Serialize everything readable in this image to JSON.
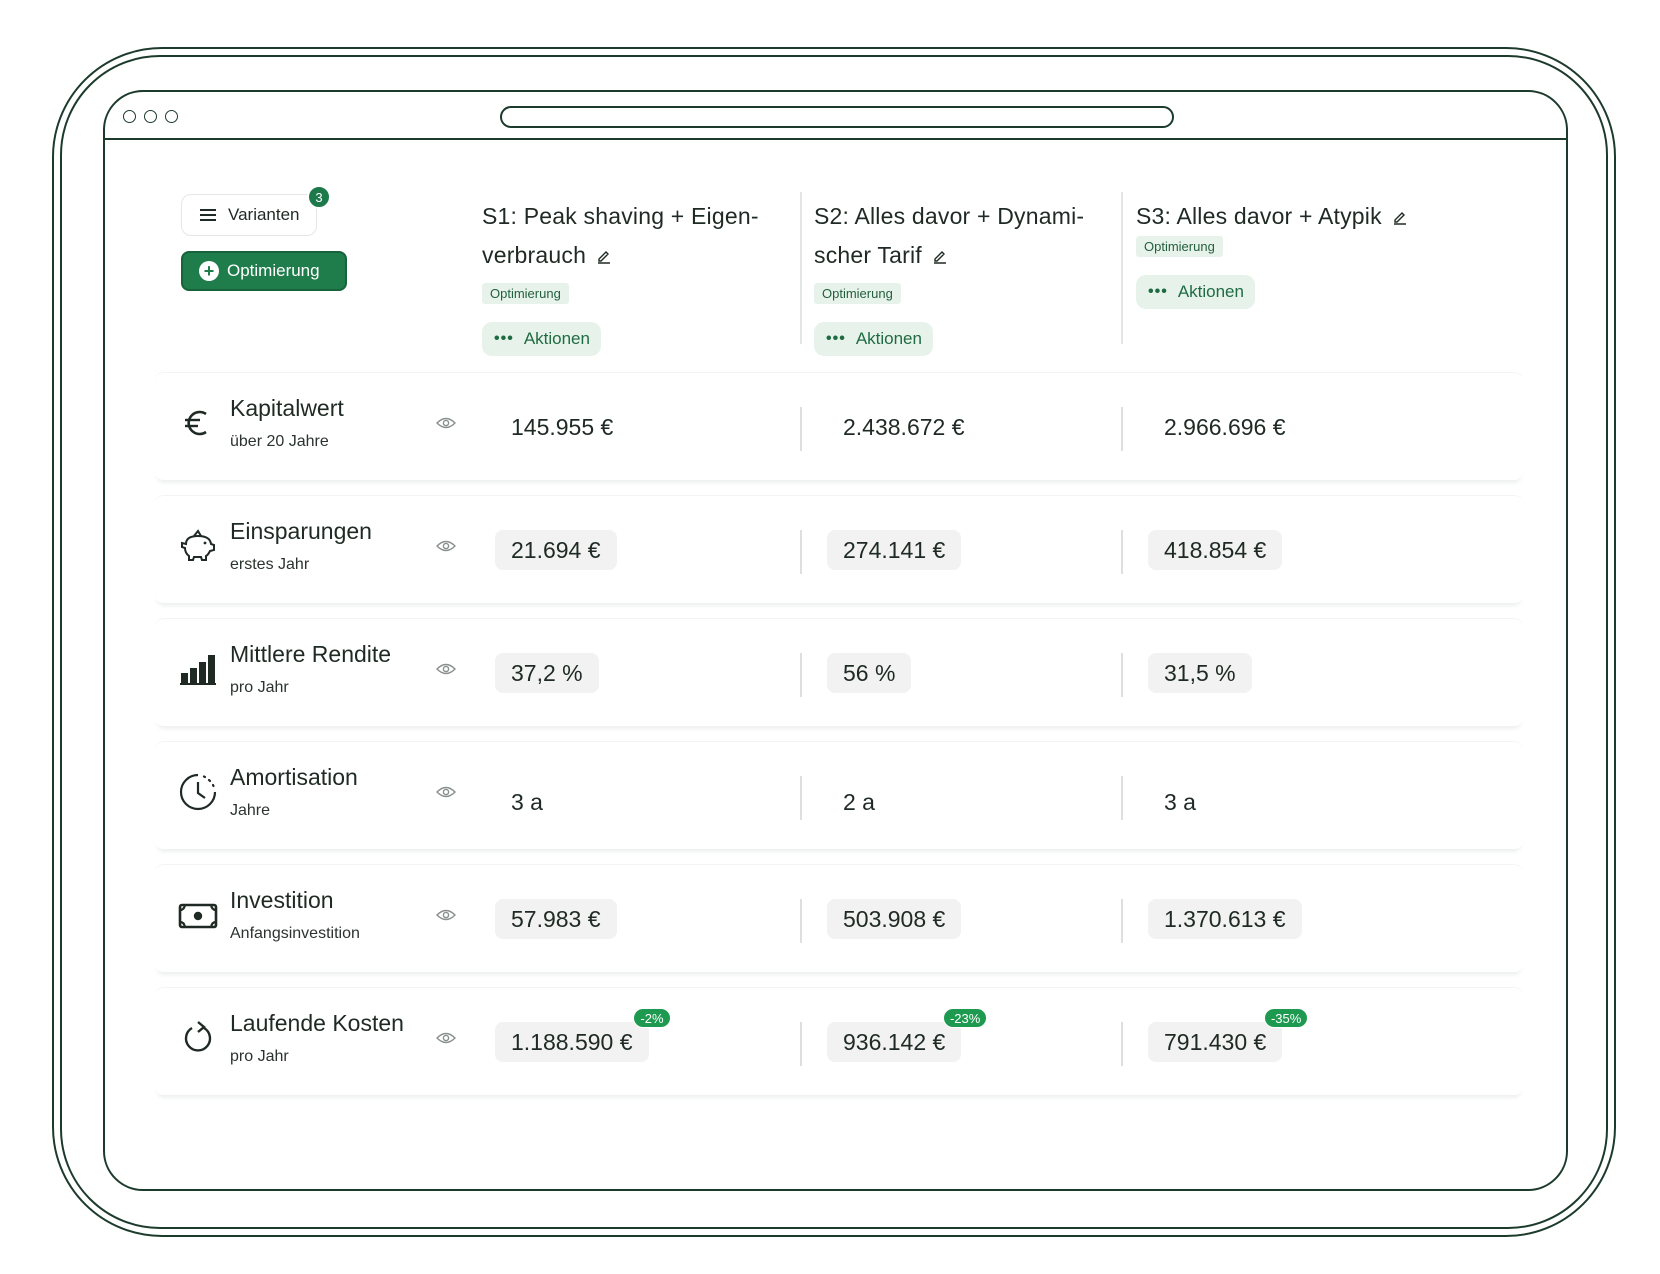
{
  "header": {
    "variants_label": "Varianten",
    "variants_count": "3",
    "optimize_label": "Optimierung"
  },
  "scenarios": [
    {
      "title_line1": "S1: Peak shaving + Eigen-",
      "title_line2": "verbrauch",
      "tag": "Optimierung",
      "actions": "Aktionen"
    },
    {
      "title_line1": "S2: Alles davor + Dynami-",
      "title_line2": "scher Tarif",
      "tag": "Optimierung",
      "actions": "Aktionen"
    },
    {
      "title_line1": "S3: Alles davor + Atypik",
      "title_line2": "",
      "tag": "Optimierung",
      "actions": "Aktionen"
    }
  ],
  "metrics": [
    {
      "icon": "euro-icon",
      "label": "Kapitalwert",
      "sub": "über 20 Jahre",
      "values": [
        "145.955 €",
        "2.438.672 €",
        "2.966.696 €"
      ],
      "pill": false
    },
    {
      "icon": "piggy-bank-icon",
      "label": "Einsparungen",
      "sub": "erstes Jahr",
      "values": [
        "21.694 €",
        "274.141 €",
        "418.854 €"
      ],
      "pill": true
    },
    {
      "icon": "bar-chart-icon",
      "label": "Mittlere Rendite",
      "sub": "pro Jahr",
      "values": [
        "37,2 %",
        "56 %",
        "31,5 %"
      ],
      "pill": true
    },
    {
      "icon": "clock-icon",
      "label": "Amortisation",
      "sub": "Jahre",
      "values": [
        "3 a",
        "2 a",
        "3 a"
      ],
      "pill": false
    },
    {
      "icon": "banknote-icon",
      "label": "Investition",
      "sub": "Anfangsinvestition",
      "values": [
        "57.983 €",
        "503.908 €",
        "1.370.613 €"
      ],
      "pill": true
    },
    {
      "icon": "refresh-icon",
      "label": "Laufende Kosten",
      "sub": "pro Jahr",
      "values": [
        "1.188.590 €",
        "936.142 €",
        "791.430 €"
      ],
      "deltas": [
        "-2%",
        "-23%",
        "-35%"
      ],
      "pill": true
    }
  ],
  "colors": {
    "accent": "#1e7d4b",
    "tag_bg": "#e7f3ea",
    "frame": "#1d3b2c"
  }
}
